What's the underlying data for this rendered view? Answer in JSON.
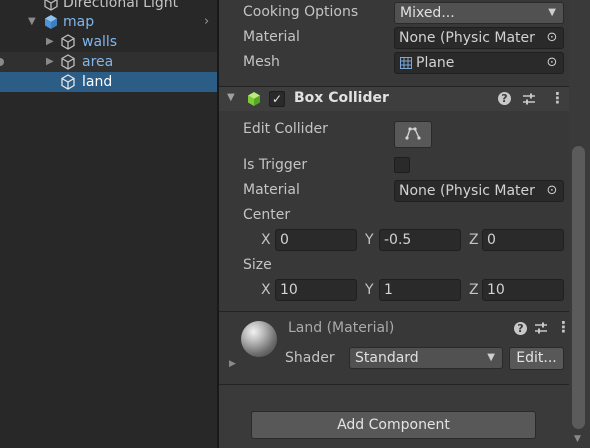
{
  "hierarchy": {
    "items": [
      {
        "label": "Directional Light"
      },
      {
        "label": "map"
      },
      {
        "label": "walls"
      },
      {
        "label": "area"
      },
      {
        "label": "land"
      }
    ]
  },
  "mesh_collider": {
    "cooking_options_label": "Cooking Options",
    "cooking_options_value": "Mixed...",
    "material_label": "Material",
    "material_value": "None (Physic Mater",
    "mesh_label": "Mesh",
    "mesh_value": "Plane"
  },
  "box_collider": {
    "title": "Box Collider",
    "enabled": true,
    "edit_collider_label": "Edit Collider",
    "is_trigger_label": "Is Trigger",
    "is_trigger": false,
    "material_label": "Material",
    "material_value": "None (Physic Mater",
    "center_label": "Center",
    "center": {
      "x_label": "X",
      "x": "0",
      "y_label": "Y",
      "y": "-0.5",
      "z_label": "Z",
      "z": "0"
    },
    "size_label": "Size",
    "size": {
      "x_label": "X",
      "x": "10",
      "y_label": "Y",
      "y": "1",
      "z_label": "Z",
      "z": "10"
    }
  },
  "material": {
    "title": "Land (Material)",
    "shader_label": "Shader",
    "shader_value": "Standard",
    "edit_label": "Edit..."
  },
  "add_component_label": "Add Component",
  "colors": {
    "selection": "#2c5d87",
    "prefab_blue": "#5a9bd8",
    "collider_green": "#7ecb3a"
  }
}
